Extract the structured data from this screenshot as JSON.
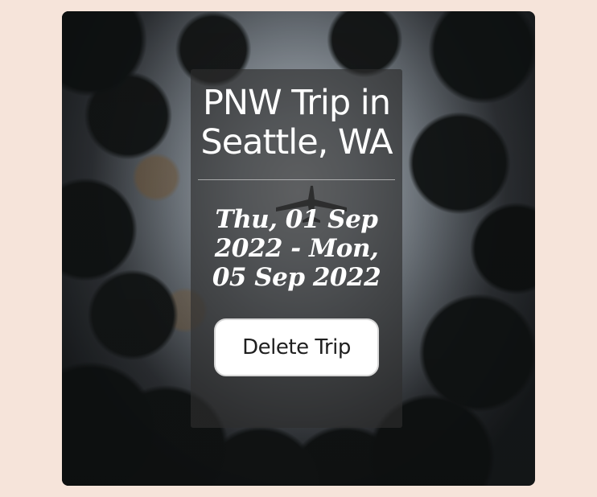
{
  "trip": {
    "title": "PNW Trip in Seattle, WA",
    "dates": "Thu, 01 Sep 2022 - Mon, 05 Sep 2022"
  },
  "actions": {
    "delete_label": "Delete Trip"
  },
  "icons": {
    "plane": "airplane-icon"
  },
  "colors": {
    "page_background": "#f6e4da",
    "overlay": "#2d2d2d",
    "button_background": "#ffffff"
  }
}
